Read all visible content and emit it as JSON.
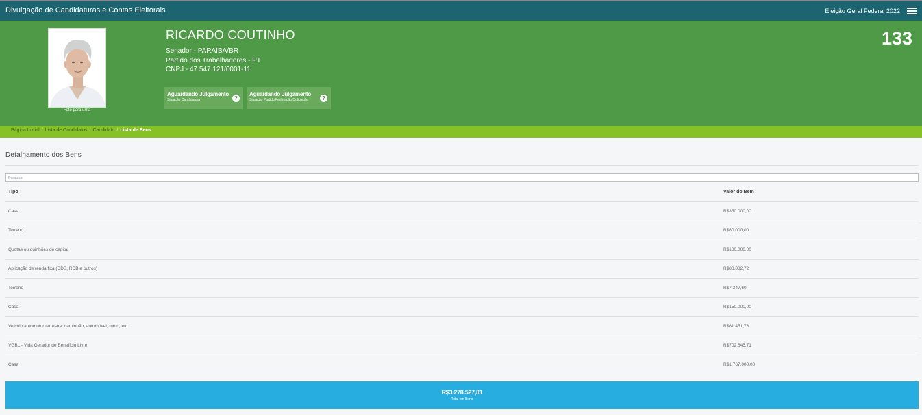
{
  "topbar": {
    "app_title": "Divulgação de Candidaturas e Contas Eleitorais",
    "election": "Eleição Geral Federal 2022",
    "menu_icon": "hamburger-menu-icon"
  },
  "candidate": {
    "name": "RICARDO COUTINHO",
    "office": "Senador - PARAÍBA/BR",
    "party": "Partido dos Trabalhadores - PT",
    "cnpj": "CNPJ - 47.547.121/0001-11",
    "number": "133",
    "photo_caption": "Foto para urna",
    "badges": [
      {
        "title": "Aguardando Julgamento",
        "subtitle": "Situação Candidatura",
        "icon": "help-circle-icon"
      },
      {
        "title": "Aguardando Julgamento",
        "subtitle": "Situação Partido/Federação/Coligação",
        "icon": "help-circle-icon"
      }
    ]
  },
  "breadcrumb": {
    "items": [
      "Página Inicial",
      "Lista de Candidatos",
      "Candidato",
      "Lista de Bens"
    ],
    "separator": "/"
  },
  "main": {
    "title": "Detalhamento dos Bens",
    "search_placeholder": "Pesquisa",
    "columns": [
      "Tipo",
      "Valor do Bem"
    ],
    "rows": [
      {
        "tipo": "Casa",
        "valor": "R$350.000,00"
      },
      {
        "tipo": "Terreno",
        "valor": "R$60.000,00"
      },
      {
        "tipo": "Quotas ou quinhões de capital",
        "valor": "R$100.000,00"
      },
      {
        "tipo": "Aplicação de renda fixa (CDB, RDB e outros)",
        "valor": "R$80.082,72"
      },
      {
        "tipo": "Terreno",
        "valor": "R$7.347,60"
      },
      {
        "tipo": "Casa",
        "valor": "R$150.000,00"
      },
      {
        "tipo": "Veículo automotor terrestre: caminhão, automóvel, moto, etc.",
        "valor": "R$61.451,78"
      },
      {
        "tipo": "VGBL - Vida Gerador de Benefício Livre",
        "valor": "R$702.645,71"
      },
      {
        "tipo": "Casa",
        "valor": "R$1.767.000,00"
      }
    ],
    "total_amount": "R$3.278.527,81",
    "total_label": "Total em Bens"
  },
  "colors": {
    "topbar": "#1b6470",
    "hero": "#4f9a47",
    "breadcrumb": "#86c226",
    "total": "#27ade0"
  }
}
